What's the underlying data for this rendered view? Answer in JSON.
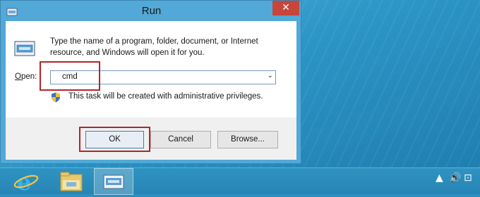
{
  "window": {
    "title": "Run",
    "close_glyph": "✕",
    "icon": "run-icon"
  },
  "dialog": {
    "description": "Type the name of a program, folder, document, or Internet resource, and Windows will open it for you.",
    "open_label_access_key": "O",
    "open_label_rest": "pen:",
    "open_value": "cmd",
    "combo_arrow": "⌄",
    "admin_note": "This task will be created with administrative privileges."
  },
  "buttons": {
    "ok": "OK",
    "cancel": "Cancel",
    "browse": "Browse..."
  },
  "highlights": {
    "color": "#b0262b"
  },
  "taskbar": {
    "items": [
      "internet-explorer-icon",
      "file-explorer-icon",
      "run-icon"
    ],
    "tray": {
      "up_arrow": "▲",
      "speaker": "🔊",
      "network": "⊡"
    }
  }
}
